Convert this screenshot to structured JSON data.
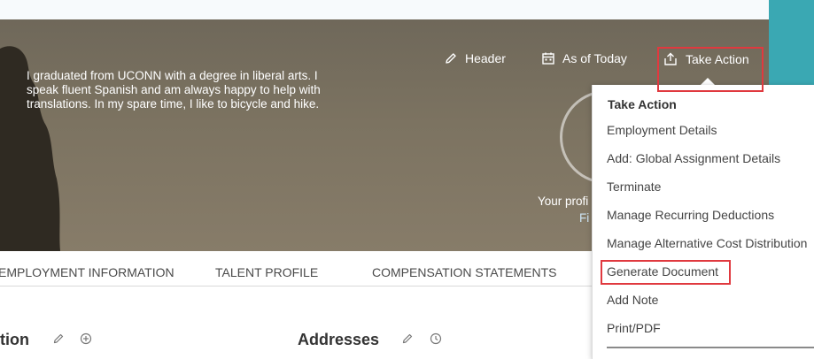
{
  "hero": {
    "bio": "I graduated from UCONN with a degree in liberal arts. I speak fluent Spanish and am always happy to help with translations. In my spare time, I like to bicycle and hike.",
    "actions": {
      "header_label": "Header",
      "as_of_label": "As of Today",
      "take_action_label": "Take Action"
    },
    "profile_text": "Your profi",
    "profile_link": "Fi"
  },
  "tabs": [
    {
      "label": "EMPLOYMENT INFORMATION"
    },
    {
      "label": "TALENT PROFILE"
    },
    {
      "label": "COMPENSATION STATEMENTS"
    }
  ],
  "sections": {
    "left_title": "tion",
    "addresses_title": "Addresses"
  },
  "menu": {
    "heading": "Take Action",
    "items": [
      {
        "label": "Employment Details"
      },
      {
        "label": "Add: Global Assignment Details"
      },
      {
        "label": "Terminate"
      },
      {
        "label": "Manage Recurring Deductions"
      },
      {
        "label": "Manage Alternative Cost Distribution"
      },
      {
        "label": "Generate Document"
      },
      {
        "label": "Add Note"
      },
      {
        "label": "Print/PDF"
      }
    ]
  },
  "colors": {
    "accent_teal": "#3aa8b3",
    "highlight_red": "#e0393f",
    "hero_bg": "#7c7361"
  },
  "icons": {
    "header": "pencil-icon",
    "as_of": "calendar-icon",
    "take_action": "share-icon",
    "edit": "pencil-icon",
    "add": "plus-circle-icon",
    "history": "clock-icon"
  }
}
